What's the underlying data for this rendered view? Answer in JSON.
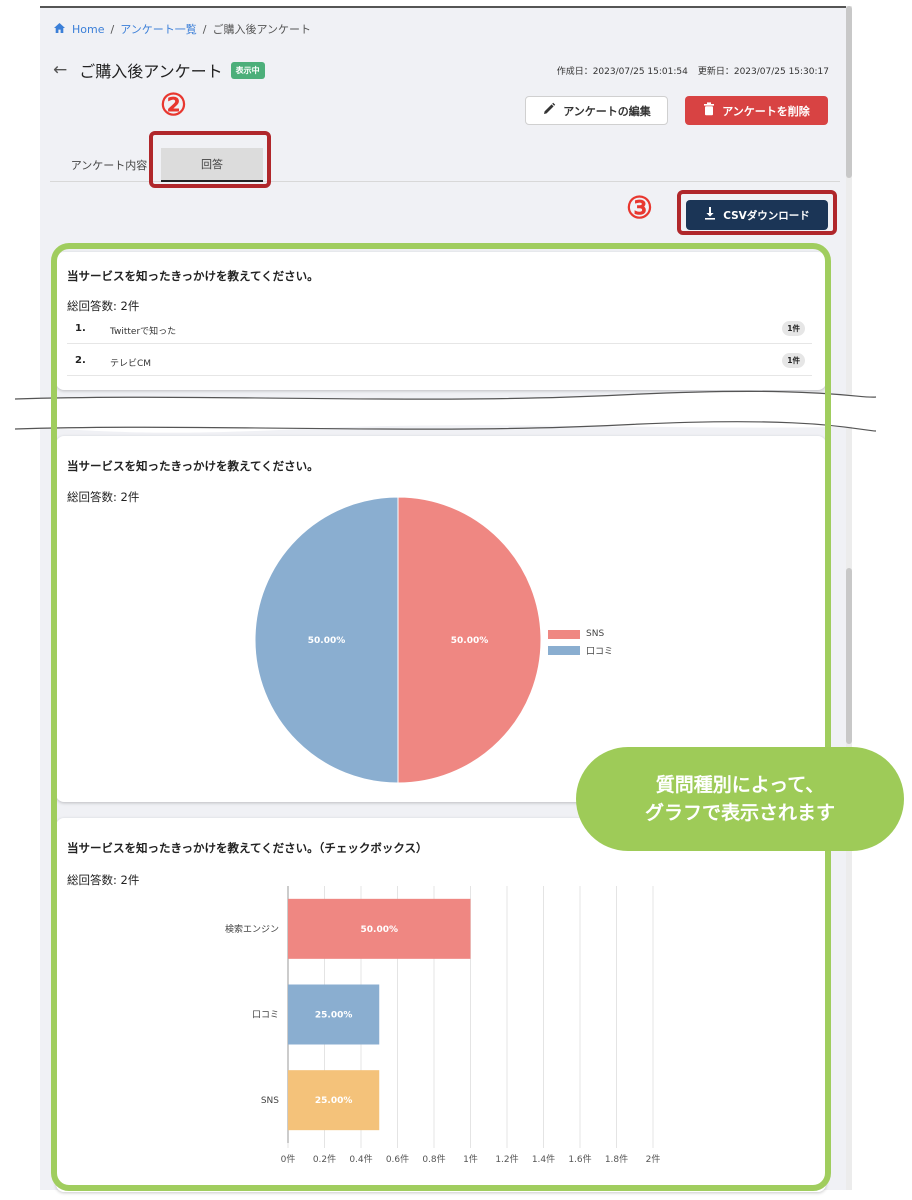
{
  "breadcrumb": {
    "home": "Home",
    "survey_list": "アンケート一覧",
    "current": "ご購入後アンケート",
    "separator": "/"
  },
  "header": {
    "title": "ご購入後アンケート",
    "status": "表示中",
    "created": "作成日：2023/07/25 15:01:54",
    "updated": "更新日：2023/07/25 15:30:17"
  },
  "actions": {
    "edit_label": "アンケートの編集",
    "delete_label": "アンケートを削除",
    "csv_label": "CSVダウンロード"
  },
  "tabs": [
    {
      "label": "アンケート内容"
    },
    {
      "label": "回答"
    }
  ],
  "annotations": {
    "mark_2": "②",
    "mark_3": "③",
    "note_line1": "質問種別によって、",
    "note_line2": "グラフで表示されます"
  },
  "colors": {
    "accent_red": "#d84343",
    "navy": "#1b3556",
    "highlight_green": "#a0cd5e",
    "callout_red": "#b0272b"
  },
  "card_text": {
    "title": "当サービスを知ったきっかけを教えてください。",
    "total": "総回答数: 2件",
    "items": [
      {
        "num": "1.",
        "text": "Twitterで知った",
        "count": "1件"
      },
      {
        "num": "2.",
        "text": "テレビCM",
        "count": "1件"
      }
    ]
  },
  "card_pie": {
    "title": "当サービスを知ったきっかけを教えてください。",
    "total": "総回答数: 2件"
  },
  "card_bar": {
    "title": "当サービスを知ったきっかけを教えてください。（チェックボックス）",
    "total": "総回答数: 2件"
  },
  "chart_data": [
    {
      "type": "pie",
      "title": "",
      "series": [
        {
          "name": "SNS",
          "value": 50.0,
          "label": "50.00%",
          "color": "#ef8782"
        },
        {
          "name": "口コミ",
          "value": 50.0,
          "label": "50.00%",
          "color": "#8aaed0"
        }
      ],
      "legend_position": "right"
    },
    {
      "type": "bar",
      "orientation": "horizontal",
      "title": "",
      "categories": [
        "検索エンジン",
        "口コミ",
        "SNS"
      ],
      "values": [
        1,
        0.5,
        0.5
      ],
      "labels": [
        "50.00%",
        "25.00%",
        "25.00%"
      ],
      "colors": [
        "#ef8782",
        "#8aaed0",
        "#f4c27a"
      ],
      "xlim": [
        0,
        2
      ],
      "xticks": [
        "0件",
        "0.2件",
        "0.4件",
        "0.6件",
        "0.8件",
        "1件",
        "1.2件",
        "1.4件",
        "1.6件",
        "1.8件",
        "2件"
      ],
      "grid": true
    }
  ]
}
